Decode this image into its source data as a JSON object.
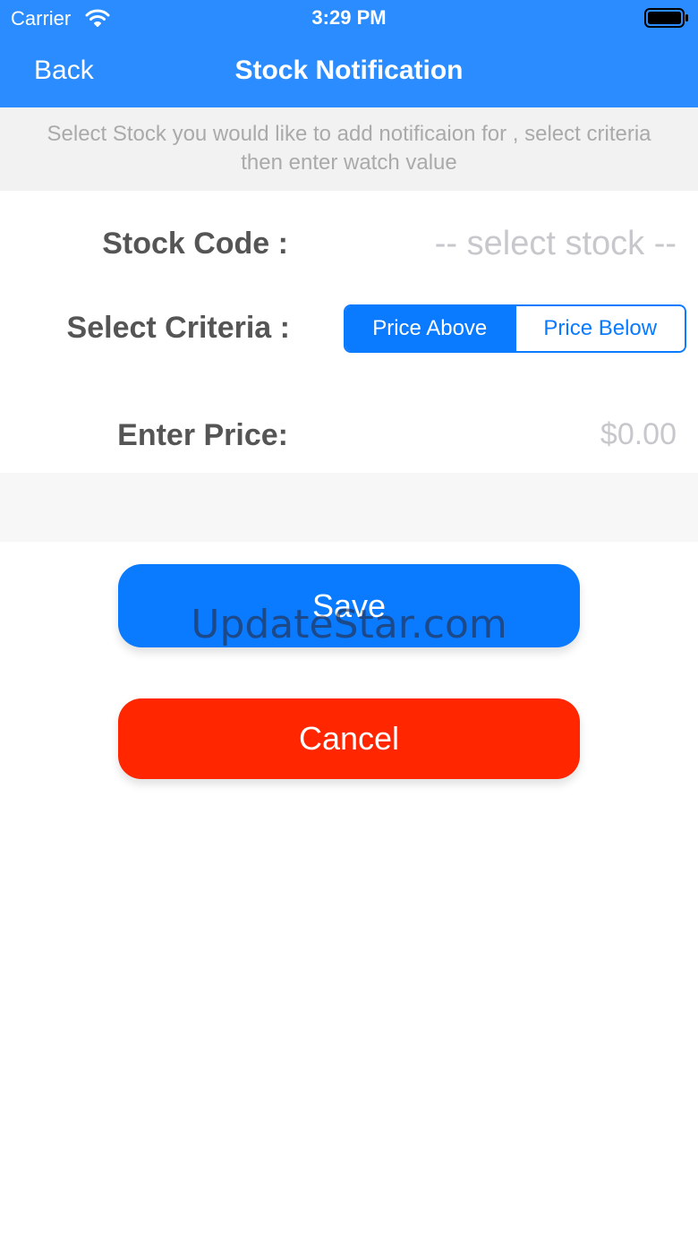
{
  "status_bar": {
    "carrier": "Carrier",
    "time": "3:29 PM"
  },
  "nav": {
    "back_label": "Back",
    "title": "Stock Notification"
  },
  "instructions": {
    "line1": "Select Stock you would like to add notificaion for , select criteria",
    "line2": "then enter watch value"
  },
  "form": {
    "stock_code_label": "Stock Code :",
    "stock_placeholder": "-- select stock --",
    "criteria_label": "Select Criteria :",
    "criteria_options": [
      "Price Above",
      "Price Below"
    ],
    "criteria_selected": "Price Above",
    "price_label": "Enter Price:",
    "price_placeholder": "$0.00"
  },
  "buttons": {
    "save_label": "Save",
    "cancel_label": "Cancel"
  },
  "watermark": "UpdateStar.com",
  "colors": {
    "nav_blue": "#2a8cff",
    "save_blue": "#0a7aff",
    "cancel_red": "#ff2600"
  }
}
